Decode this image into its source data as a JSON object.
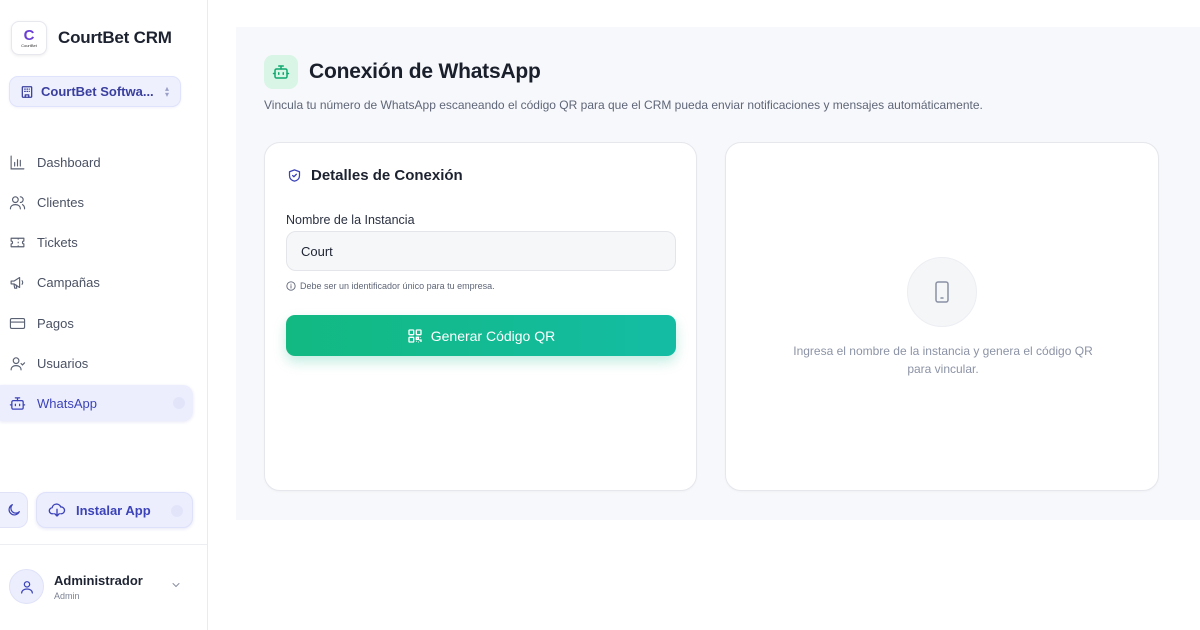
{
  "brand": {
    "name": "CourtBet CRM",
    "logo_mark": "C",
    "logo_text": "CourtBet"
  },
  "org_selector": {
    "label": "CourtBet Softwa...",
    "icon": "building-icon"
  },
  "nav": {
    "items": [
      {
        "label": "Dashboard",
        "icon": "bar-chart-icon"
      },
      {
        "label": "Clientes",
        "icon": "users-icon"
      },
      {
        "label": "Tickets",
        "icon": "ticket-icon"
      },
      {
        "label": "Campañas",
        "icon": "megaphone-icon"
      },
      {
        "label": "Pagos",
        "icon": "credit-card-icon"
      },
      {
        "label": "Usuarios",
        "icon": "user-icon"
      },
      {
        "label": "WhatsApp",
        "icon": "bot-icon",
        "active": true
      }
    ]
  },
  "actions": {
    "install_label": "Instalar App",
    "theme_icon": "moon-icon"
  },
  "user": {
    "name": "Administrador",
    "role": "Admin"
  },
  "page": {
    "title": "Conexión de WhatsApp",
    "subtitle": "Vincula tu número de WhatsApp escaneando el código QR para que el CRM pueda enviar notificaciones y mensajes automáticamente."
  },
  "connection_card": {
    "title": "Detalles de Conexión",
    "field_label": "Nombre de la Instancia",
    "field_value": "Court",
    "hint": "Debe ser un identificador único para tu empresa.",
    "button_label": "Generar Código QR"
  },
  "qr_card": {
    "placeholder_text": "Ingresa el nombre de la instancia y genera el código QR para vincular."
  },
  "colors": {
    "accent": "#3c43b8",
    "success": "#12b981",
    "sidebar_active_bg": "#eceefd"
  }
}
